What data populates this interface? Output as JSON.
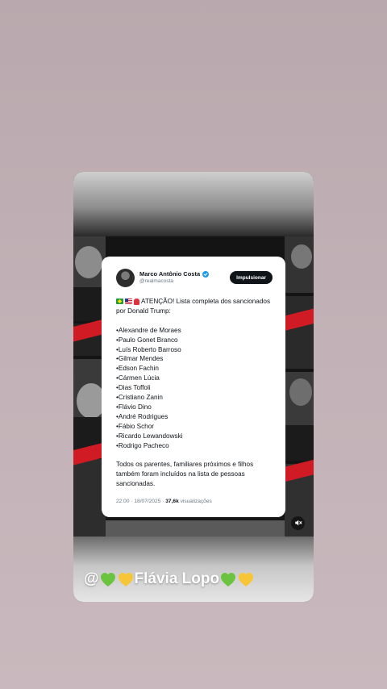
{
  "tweet": {
    "author_name": "Marco Antônio Costa",
    "handle": "@realmacosta",
    "promote_label": "Impulsionar",
    "headline": "ATENÇÃO! Lista completa dos sancionados por Donald Trump:",
    "names": [
      "•Alexandre de Moraes",
      "•Paulo Gonet Branco",
      "•Luís Roberto Barroso",
      "•Gilmar Mendes",
      "•Edson Fachin",
      "•Cármen Lúcia",
      "•Dias Toffoli",
      "•Cristiano Zanin",
      "•Flávio Dino",
      "•André Rodrigues",
      "•Fábio Schor",
      "•Ricardo Lewandowski",
      "•Rodrigo Pacheco"
    ],
    "footer_text": "Todos os parentes, familiares próximos e filhos também foram incluídos na lista de pessoas sancionadas.",
    "timestamp": "22:00 · 18/07/2025 · ",
    "views_count": "37,6k",
    "views_label": " visualizações"
  },
  "caption": {
    "prefix": "@",
    "name": "Flávia Lopo"
  },
  "icons": {
    "verified": "verified-badge-icon",
    "flags": [
      "brazil-flag-icon",
      "usa-flag-icon",
      "siren-icon"
    ],
    "mute": "speaker-muted-icon",
    "hearts": [
      "green-heart-icon",
      "yellow-heart-icon"
    ]
  },
  "colors": {
    "verified": "#1d9bf0",
    "stamp_red": "#d11b24",
    "heart_green": "#6bc43f",
    "heart_yellow": "#f6c636"
  }
}
